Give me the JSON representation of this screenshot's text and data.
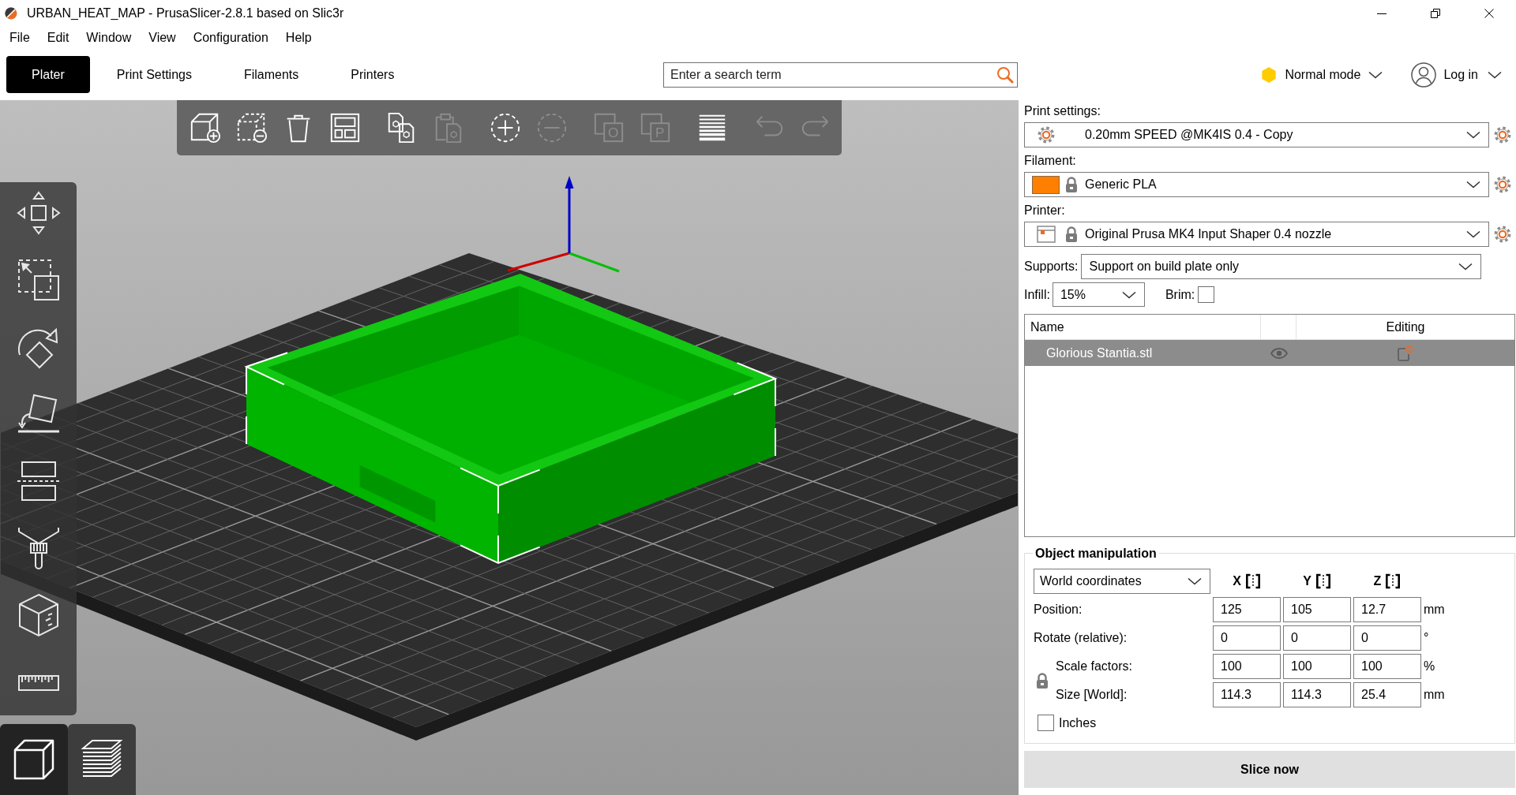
{
  "window": {
    "title": "URBAN_HEAT_MAP - PrusaSlicer-2.8.1 based on Slic3r"
  },
  "menu": [
    "File",
    "Edit",
    "Window",
    "View",
    "Configuration",
    "Help"
  ],
  "tabs": [
    {
      "label": "Plater",
      "selected": true
    },
    {
      "label": "Print Settings",
      "selected": false
    },
    {
      "label": "Filaments",
      "selected": false
    },
    {
      "label": "Printers",
      "selected": false
    }
  ],
  "search": {
    "placeholder": "Enter a search term"
  },
  "mode": {
    "label": "Normal mode"
  },
  "account": {
    "label": "Log in"
  },
  "toolbar": [
    {
      "kind": "add",
      "disabled": false
    },
    {
      "kind": "delete",
      "disabled": false
    },
    {
      "kind": "delete_all",
      "disabled": false
    },
    {
      "kind": "arrange",
      "disabled": false
    },
    {
      "kind": "copy",
      "disabled": false
    },
    {
      "kind": "paste",
      "disabled": true
    },
    {
      "kind": "add_instance",
      "disabled": false
    },
    {
      "kind": "remove_instance",
      "disabled": true
    },
    {
      "kind": "split_objects",
      "disabled": true,
      "glyph": "O"
    },
    {
      "kind": "split_parts",
      "disabled": true,
      "glyph": "P"
    },
    {
      "kind": "layers",
      "disabled": false
    },
    {
      "kind": "undo",
      "disabled": true
    },
    {
      "kind": "redo",
      "disabled": true
    }
  ],
  "view_buttons": [
    {
      "kind": "model",
      "selected": true
    },
    {
      "kind": "preview",
      "selected": false
    }
  ],
  "presets": [
    {
      "kind": "print",
      "label": "Print settings:",
      "value": "0.20mm SPEED @MK4IS 0.4 - Copy",
      "locked": false
    },
    {
      "kind": "filament",
      "label": "Filament:",
      "value": "Generic PLA",
      "locked": true
    },
    {
      "kind": "printer",
      "label": "Printer:",
      "value": "Original Prusa MK4 Input Shaper 0.4 nozzle",
      "locked": true
    }
  ],
  "supports": {
    "label": "Supports:",
    "value": "Support on build plate only"
  },
  "infill": {
    "label": "Infill:",
    "value": "15%"
  },
  "brim": {
    "label": "Brim:",
    "checked": false
  },
  "object_list": {
    "columns": [
      "Name",
      "Editing"
    ],
    "rows": [
      {
        "name": "Glorious Stantia.stl",
        "selected": true
      }
    ]
  },
  "manipulation": {
    "title": "Object manipulation",
    "coordinates": "World coordinates",
    "axes": [
      "X",
      "Y",
      "Z"
    ],
    "rows": [
      {
        "label": "Position:",
        "values": [
          "125",
          "105",
          "12.7"
        ],
        "unit": "mm"
      },
      {
        "label": "Rotate (relative):",
        "values": [
          "0",
          "0",
          "0"
        ],
        "unit": "°"
      }
    ],
    "scale_group": {
      "locked": true,
      "rows": [
        {
          "label": "Scale factors:",
          "values": [
            "100",
            "100",
            "100"
          ],
          "unit": "%"
        },
        {
          "label": "Size [World]:",
          "values": [
            "114.3",
            "114.3",
            "25.4"
          ],
          "unit": "mm"
        }
      ]
    },
    "inches": {
      "label": "Inches",
      "checked": false
    }
  },
  "slice_button": {
    "label": "Slice now"
  }
}
